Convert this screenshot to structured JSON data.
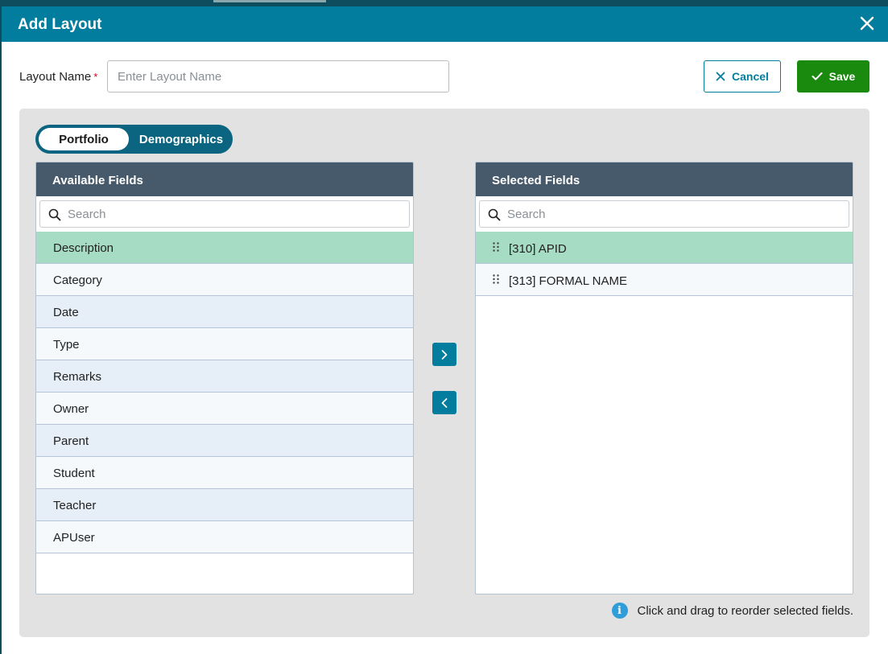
{
  "dialog": {
    "title": "Add Layout"
  },
  "form": {
    "name_label": "Layout Name",
    "required_mark": "*",
    "name_placeholder": "Enter Layout Name",
    "name_value": "",
    "cancel_label": "Cancel",
    "save_label": "Save"
  },
  "tabs": [
    {
      "label": "Portfolio",
      "active": true
    },
    {
      "label": "Demographics",
      "active": false
    }
  ],
  "available": {
    "header": "Available Fields",
    "search_placeholder": "Search",
    "items": [
      {
        "label": "Description",
        "selected": true
      },
      {
        "label": "Category"
      },
      {
        "label": "Date"
      },
      {
        "label": "Type"
      },
      {
        "label": "Remarks"
      },
      {
        "label": "Owner"
      },
      {
        "label": "Parent"
      },
      {
        "label": "Student"
      },
      {
        "label": "Teacher"
      },
      {
        "label": "APUser"
      }
    ]
  },
  "selected": {
    "header": "Selected Fields",
    "search_placeholder": "Search",
    "items": [
      {
        "label": "[310] APID",
        "selected": true
      },
      {
        "label": "[313] FORMAL NAME"
      }
    ]
  },
  "hint": {
    "text": "Click and drag to reorder selected fields."
  },
  "colors": {
    "header": "#037d9d",
    "save": "#1a8a0f",
    "selected_row": "#a6dcc4",
    "list_header": "#475a6b"
  }
}
